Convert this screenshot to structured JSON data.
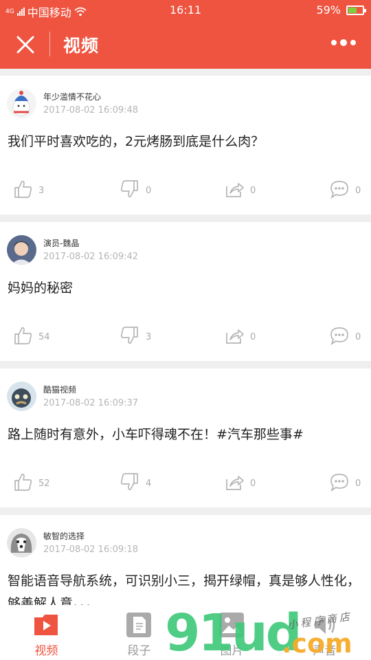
{
  "status_bar": {
    "network_label": "4G",
    "carrier": "中国移动",
    "time": "16:11",
    "battery": "59%",
    "battery_level": 0.59
  },
  "app_bar": {
    "title": "视频",
    "close_icon": "close-icon",
    "more_icon": "more-dots-icon"
  },
  "posts": [
    {
      "author": "年少滥情不花心",
      "time": "2017-08-02 16:09:48",
      "text": "我们平时喜欢吃的，2元烤肠到底是什么肉？",
      "likes": "3",
      "dislikes": "0",
      "shares": "0",
      "comments": "0"
    },
    {
      "author": "演员-魏晶",
      "time": "2017-08-02 16:09:42",
      "text": "妈妈的秘密",
      "likes": "54",
      "dislikes": "3",
      "shares": "0",
      "comments": "0"
    },
    {
      "author": "酷猫视频",
      "time": "2017-08-02 16:09:37",
      "text": "路上随时有意外，小车吓得魂不在！#汽车那些事#",
      "likes": "52",
      "dislikes": "4",
      "shares": "0",
      "comments": "0"
    },
    {
      "author": "敏智的选择",
      "time": "2017-08-02 16:09:18",
      "text": "智能语音导航系统，可识别小三，揭开绿帽，真是够人性化，够善解人意。。。",
      "likes": "",
      "dislikes": "",
      "shares": "",
      "comments": ""
    }
  ],
  "bottom_nav": [
    {
      "label": "视频",
      "icon": "video-icon",
      "active": true
    },
    {
      "label": "段子",
      "icon": "document-icon",
      "active": false
    },
    {
      "label": "图片",
      "icon": "image-icon",
      "active": false
    },
    {
      "label": "声音",
      "icon": "sound-icon",
      "active": false
    }
  ],
  "watermark": {
    "big": "91ud",
    "com": ".com",
    "script": "小程序商店"
  },
  "colors": {
    "accent": "#ee5440",
    "battery_fill": "#7bd13d",
    "muted_text": "#b5b5b5"
  }
}
